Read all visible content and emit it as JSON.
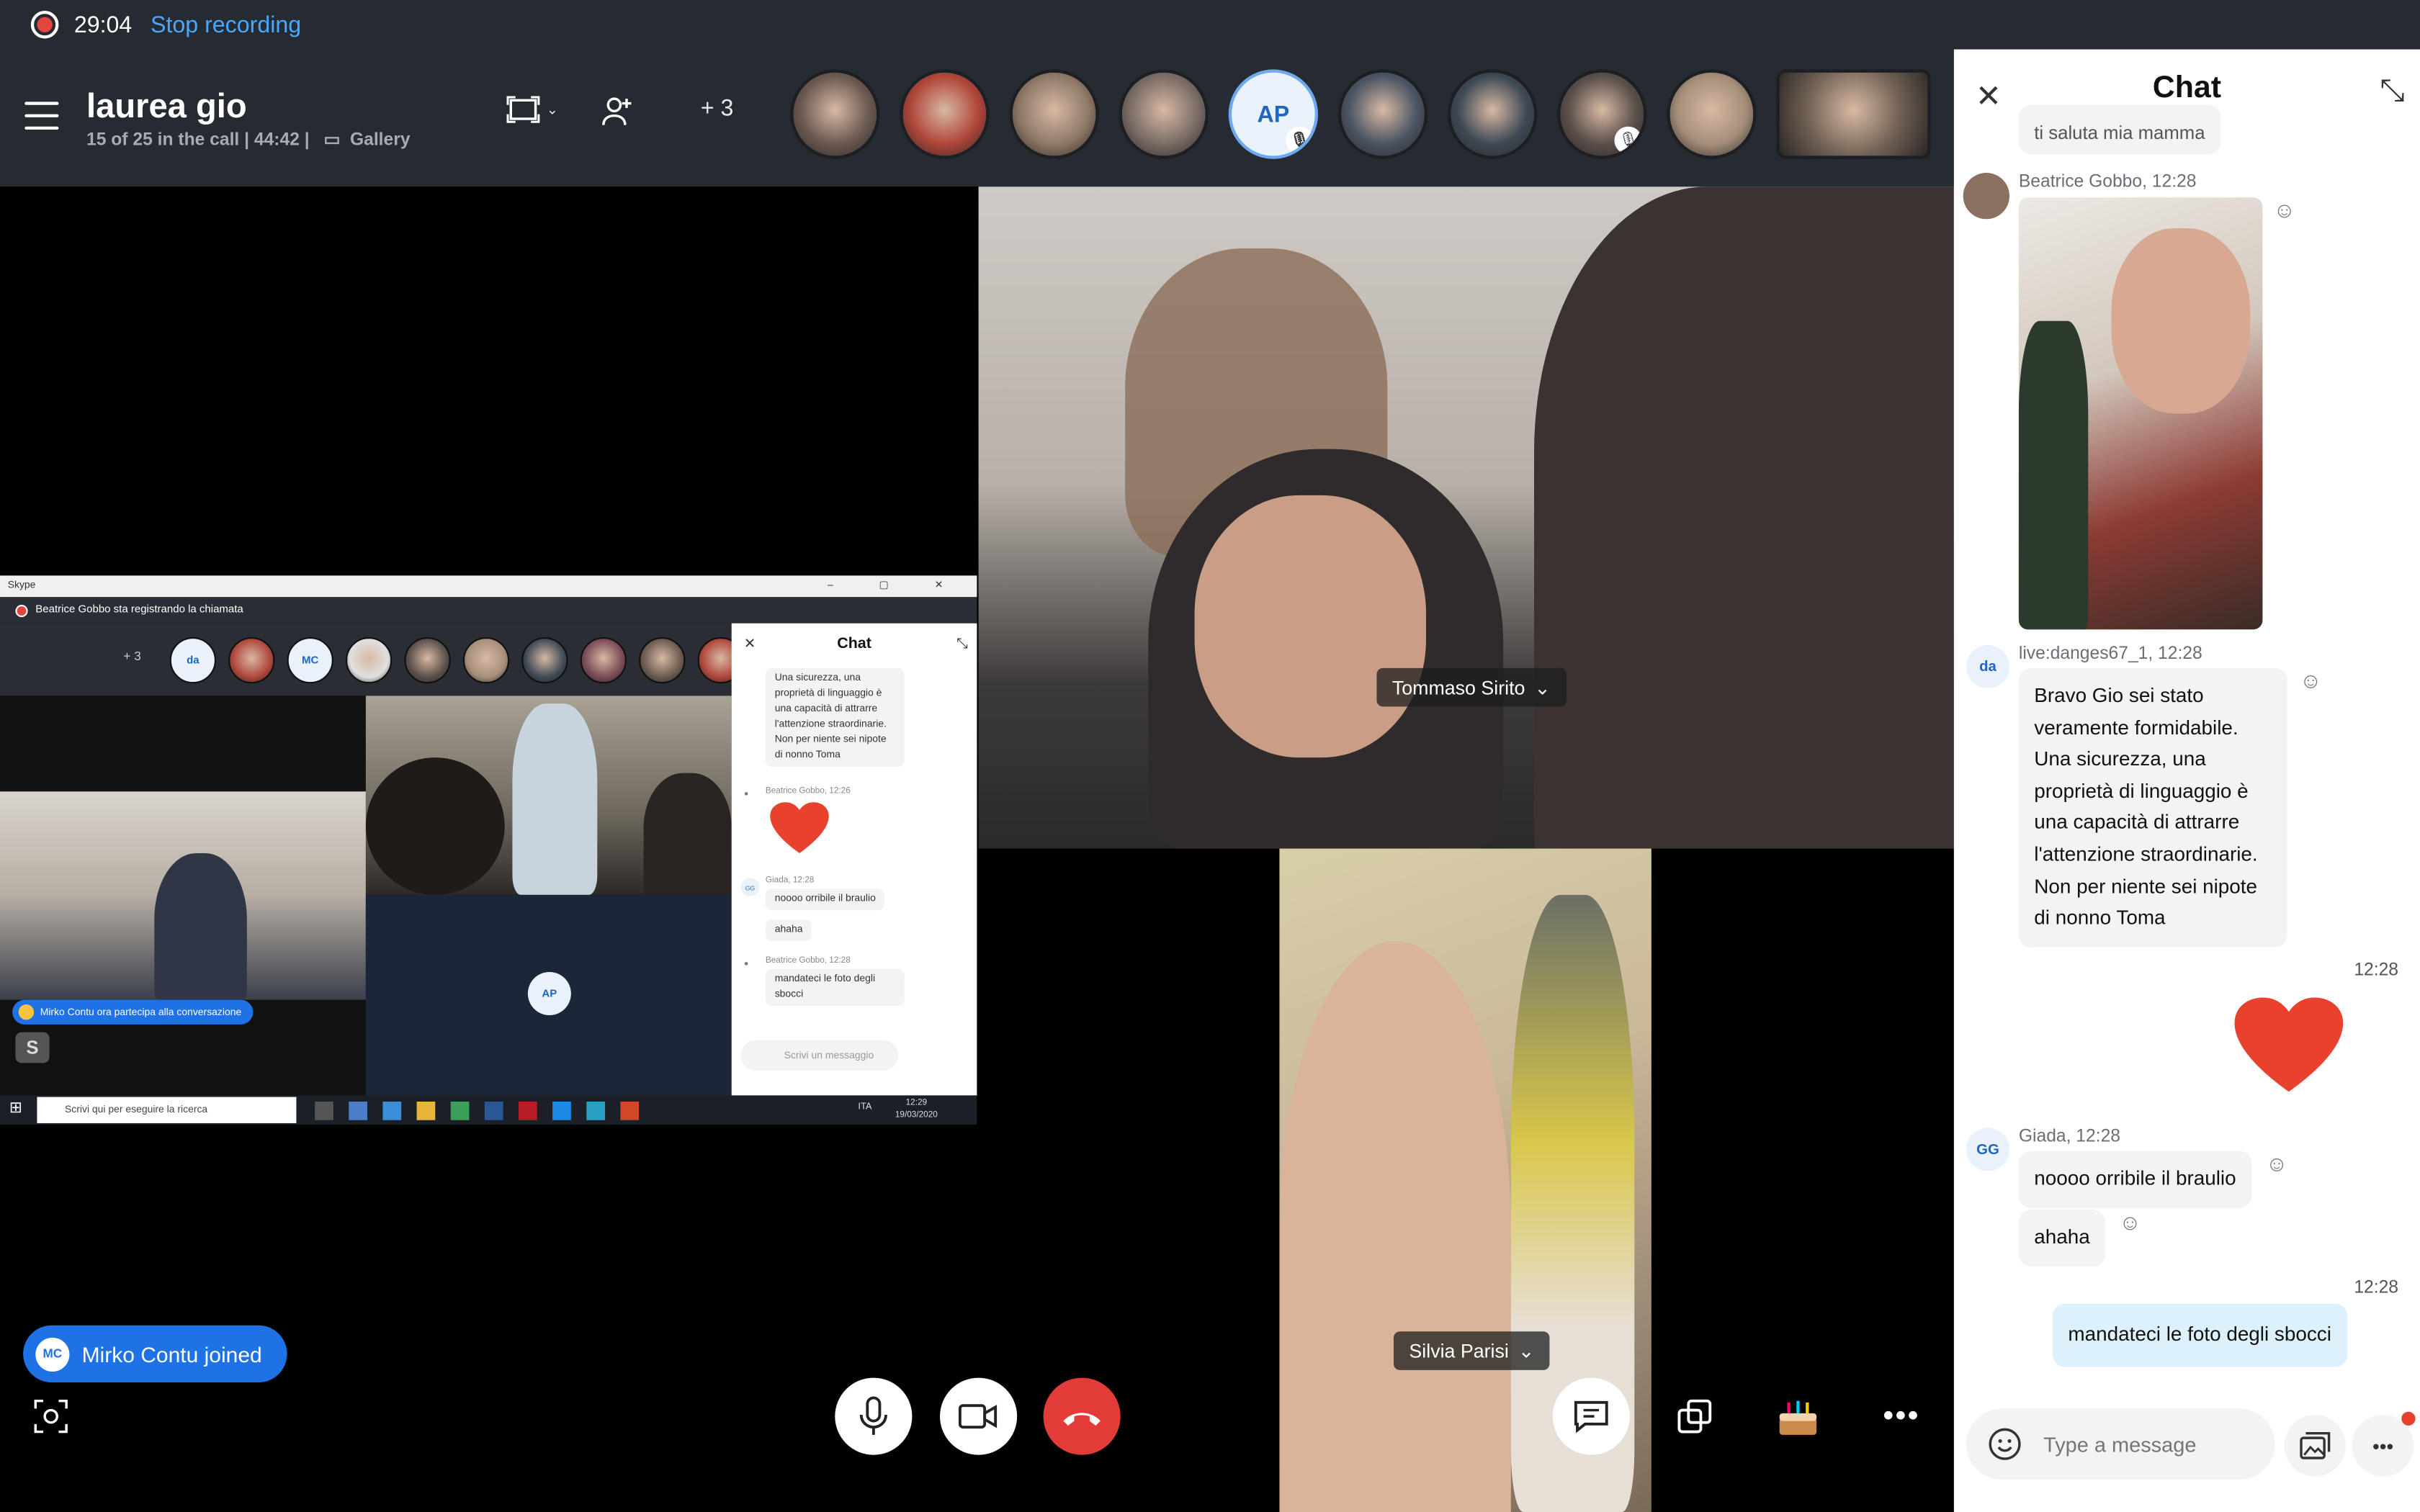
{
  "recording": {
    "time": "29:04",
    "stop_label": "Stop recording"
  },
  "call": {
    "title": "laurea gio",
    "subtitle": "15 of 25 in the call | 44:42 |",
    "view_mode": "Gallery",
    "more_count": "+ 3"
  },
  "participants_bar": [
    {
      "kind": "photo",
      "muted": false,
      "color": "#6b5a50"
    },
    {
      "kind": "photo",
      "muted": false,
      "color": "#b0463a"
    },
    {
      "kind": "photo",
      "muted": false,
      "color": "#8f7a68"
    },
    {
      "kind": "photo",
      "muted": false,
      "color": "#7a6d66"
    },
    {
      "kind": "initials",
      "initials": "AP",
      "muted": true
    },
    {
      "kind": "photo",
      "muted": false,
      "color": "#4b5563"
    },
    {
      "kind": "photo",
      "muted": false,
      "color": "#3f4a55"
    },
    {
      "kind": "photo",
      "muted": true,
      "color": "#5a4f4a"
    },
    {
      "kind": "photo",
      "muted": false,
      "color": "#a68f7a"
    },
    {
      "kind": "video",
      "muted": false,
      "color": "#6e5f52"
    }
  ],
  "tiles": {
    "tommaso": {
      "name": "Tommaso Sirito"
    },
    "silvia": {
      "name": "Silvia Parisi"
    }
  },
  "share": {
    "window_title": "Skype",
    "recording_notice": "Beatrice Gobbo sta registrando la chiamata",
    "more_count": "+ 3",
    "mini_avatars": [
      "da",
      "",
      "MC",
      "",
      "",
      "",
      "",
      "",
      "",
      ""
    ],
    "joined_notice": "Mirko Contu ora partecipa alla conversazione",
    "ap_initials": "AP",
    "chat": {
      "title": "Chat",
      "first_message": "Una sicurezza, una proprietà di linguaggio è una capacità di attrarre l'attenzione straordinarie. Non per niente sei nipote di nonno Toma",
      "sender1": "Beatrice Gobbo, 12:26",
      "sender2": "Giada, 12:28",
      "msg_a": "noooo orribile il braulio",
      "msg_b": "ahaha",
      "sender3": "Beatrice Gobbo, 12:28",
      "msg_c": "mandateci le foto degli sbocci",
      "composer_placeholder": "Scrivi un messaggio"
    },
    "taskbar": {
      "search_placeholder": "Scrivi qui per eseguire la ricerca",
      "lang": "ITA",
      "time": "12:29",
      "date": "19/03/2020"
    }
  },
  "joined_toast": {
    "initials": "MC",
    "text": "Mirko Contu joined"
  },
  "chat": {
    "title": "Chat",
    "truncated_top": "ti saluta mia mamma",
    "beatrice_sender": "Beatrice Gobbo, 12:28",
    "danges_sender": "live:danges67_1, 12:28",
    "danges_initials": "da",
    "danges_message": "Bravo Gio sei stato veramente formidabile. Una sicurezza, una proprietà di linguaggio è una capacità di attrarre l'attenzione straordinarie. Non per niente sei nipote di nonno Toma",
    "heart_time": "12:28",
    "giada_sender": "Giada, 12:28",
    "giada_initials": "GG",
    "giada_msg1": "noooo orribile il braulio",
    "giada_msg2": "ahaha",
    "mine_time": "12:28",
    "mine_msg": "mandateci le foto degli sbocci",
    "composer_placeholder": "Type a message"
  },
  "colors": {
    "accent": "#1f72e5",
    "link": "#4aa7ff",
    "end_call": "#e33b38",
    "bar_bg": "#262a31",
    "my_bubble": "#dcf1fb",
    "their_bubble": "#f2f3f5"
  }
}
